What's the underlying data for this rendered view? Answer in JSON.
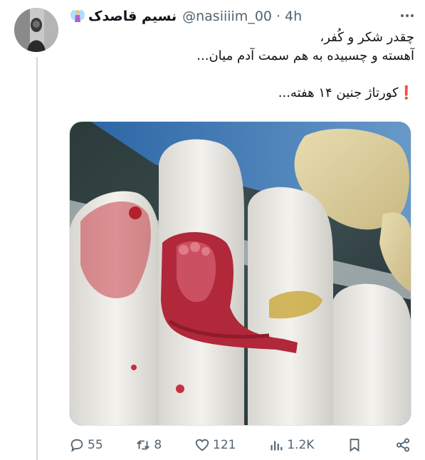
{
  "tweet": {
    "display_name": "نسیم قاصدک",
    "handle": "@nasiiiim_00",
    "separator": "·",
    "time": "4h",
    "text_lines": [
      "چقدر شکر و کُفر،",
      "آهسته و چسبیده به هم سمت آدم میان..."
    ],
    "text_after_gap": "کورتاژ جنین ۱۴ هفته...",
    "exclamation": "❗"
  },
  "icons": {
    "name_badge": "fairy-emoji-icon",
    "more": "more-dots-icon",
    "reply": "reply-icon",
    "retweet": "retweet-icon",
    "like": "heart-icon",
    "views": "views-icon",
    "bookmark": "bookmark-icon",
    "share": "share-icon"
  },
  "actions": {
    "reply_count": "55",
    "retweet_count": "8",
    "like_count": "121",
    "views_count": "1.2K"
  },
  "colors": {
    "text": "#0f1419",
    "secondary": "#536471",
    "border": "#cfd9de"
  }
}
